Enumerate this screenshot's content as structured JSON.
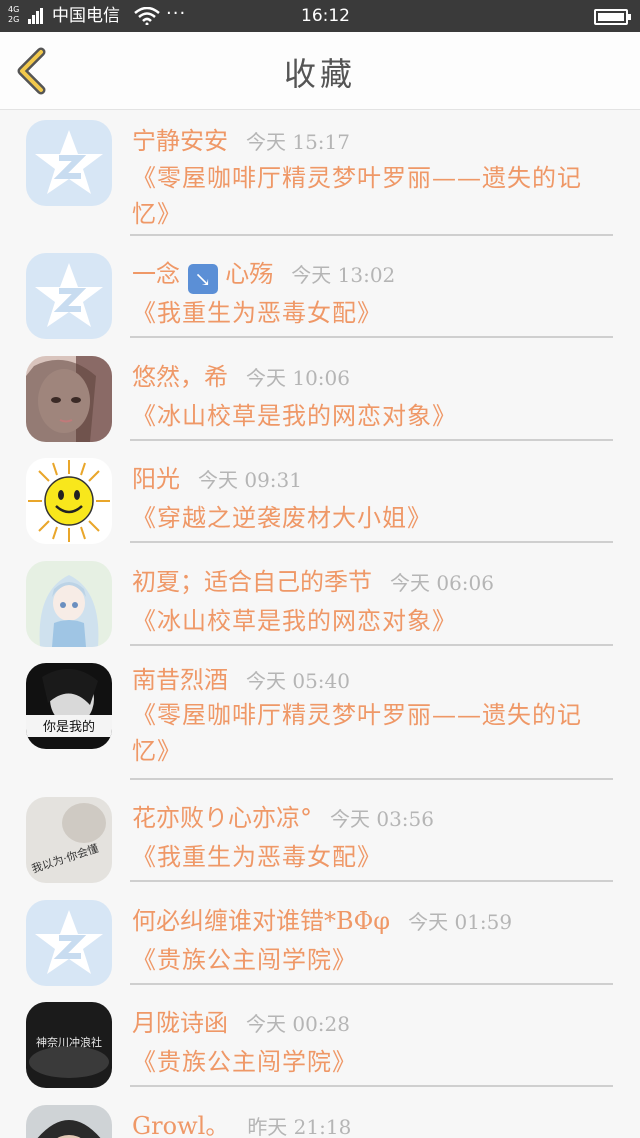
{
  "status_bar": {
    "network": "4G 2G",
    "carrier": "中国电信",
    "more": "···",
    "time": "16:12"
  },
  "nav": {
    "title": "收藏"
  },
  "items": [
    {
      "nick": "宁静安安",
      "time": "今天 15:17",
      "book": "《零屋咖啡厅精灵梦叶罗丽——遗失的记忆》",
      "avatar": "default-qq-icon"
    },
    {
      "nick_pre": "一念",
      "emoji": "↘",
      "nick_post": "心殇",
      "time": "今天 13:02",
      "book": "《我重生为恶毒女配》",
      "avatar": "default-qq-icon"
    },
    {
      "nick": "悠然，希",
      "time": "今天 10:06",
      "book": "《冰山校草是我的网恋对象》",
      "avatar": "girl-photo"
    },
    {
      "nick": "阳光",
      "time": "今天 09:31",
      "book": "《穿越之逆袭废材大小姐》",
      "avatar": "sun-icon"
    },
    {
      "nick": "初夏；适合自己的季节",
      "time": "今天 06:06",
      "book": "《冰山校草是我的网恋对象》",
      "avatar": "anime-girl"
    },
    {
      "nick": "南昔烈酒",
      "time": "今天 05:40",
      "book": "《零屋咖啡厅精灵梦叶罗丽——遗失的记忆》",
      "avatar": "bw-photo",
      "avatar_text": "你是我的"
    },
    {
      "nick": "花亦败り心亦凉°",
      "time": "今天 03:56",
      "book": "《我重生为恶毒女配》",
      "avatar": "photo-text",
      "avatar_text": "我以为·你会懂"
    },
    {
      "nick": "何必纠缠谁对谁错*ΒΦφ",
      "time": "今天 01:59",
      "book": "《贵族公主闯学院》",
      "avatar": "default-qq-icon"
    },
    {
      "nick": "月陇诗函",
      "time": "今天 00:28",
      "book": "《贵族公主闯学院》",
      "avatar": "dark-logo",
      "avatar_text": "神奈川冲浪社"
    },
    {
      "nick": "Growl。",
      "time": "昨天 21:18",
      "book": "",
      "avatar": "cap-photo"
    }
  ]
}
